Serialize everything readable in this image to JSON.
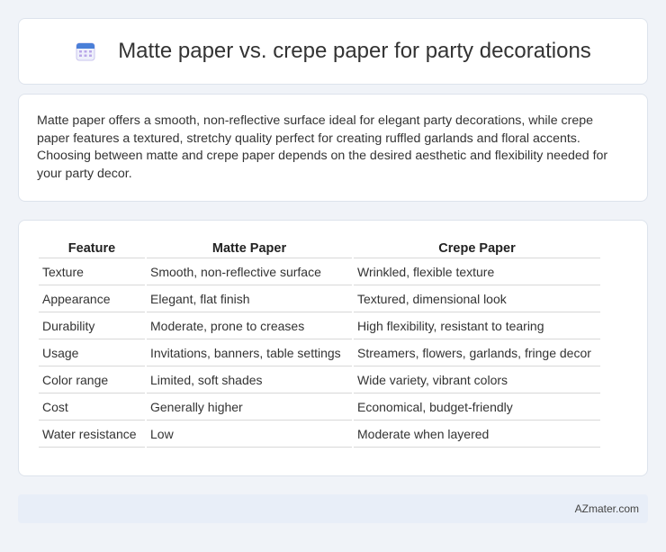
{
  "header": {
    "title": "Matte paper vs. crepe paper for party decorations",
    "icon": "calendar-icon"
  },
  "intro": {
    "text": "Matte paper offers a smooth, non-reflective surface ideal for elegant party decorations, while crepe paper features a textured, stretchy quality perfect for creating ruffled garlands and floral accents. Choosing between matte and crepe paper depends on the desired aesthetic and flexibility needed for your party decor."
  },
  "table": {
    "headers": [
      "Feature",
      "Matte Paper",
      "Crepe Paper"
    ],
    "rows": [
      [
        "Texture",
        "Smooth, non-reflective surface",
        "Wrinkled, flexible texture"
      ],
      [
        "Appearance",
        "Elegant, flat finish",
        "Textured, dimensional look"
      ],
      [
        "Durability",
        "Moderate, prone to creases",
        "High flexibility, resistant to tearing"
      ],
      [
        "Usage",
        "Invitations, banners, table settings",
        "Streamers, flowers, garlands, fringe decor"
      ],
      [
        "Color range",
        "Limited, soft shades",
        "Wide variety, vibrant colors"
      ],
      [
        "Cost",
        "Generally higher",
        "Economical, budget-friendly"
      ],
      [
        "Water resistance",
        "Low",
        "Moderate when layered"
      ]
    ]
  },
  "footer": {
    "brand": "AZmater.com"
  },
  "colors": {
    "background": "#f0f3f8",
    "card": "#ffffff",
    "footer_bg": "#e8eef8",
    "icon_blue": "#4a7fd8",
    "icon_purple": "#b9a6e8"
  }
}
